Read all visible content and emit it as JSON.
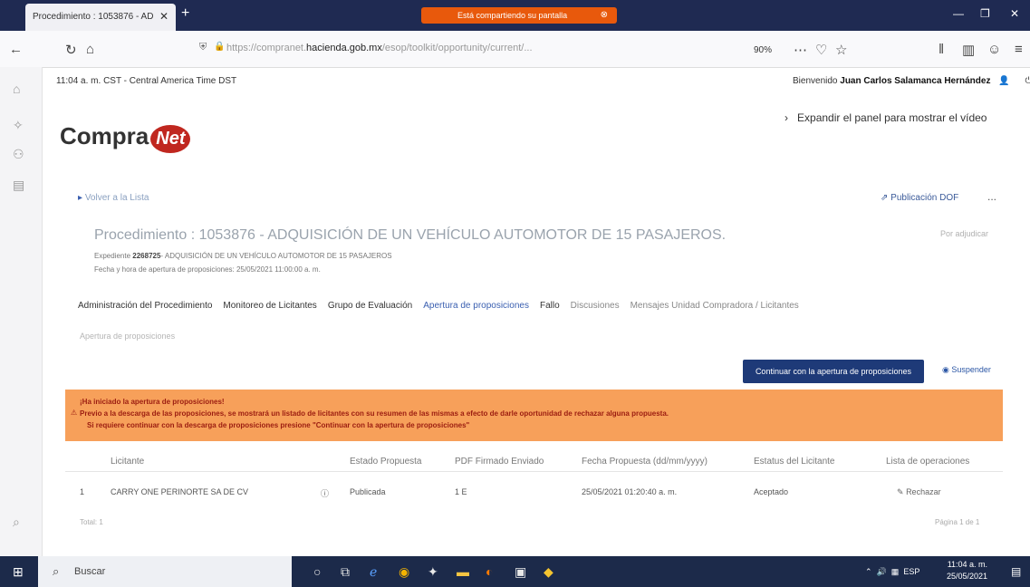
{
  "browser": {
    "tab_title": "Procedimiento : 1053876 - AD",
    "share_banner": "Está compartiendo su pantalla",
    "url_prefix": "https://compranet.",
    "url_domain": "hacienda.gob.mx",
    "url_rest": "/esop/toolkit/opportunity/current/...",
    "zoom": "90%"
  },
  "header": {
    "time_info": "11:04 a. m. CST - Central America Time DST",
    "welcome_prefix": "Bienvenido",
    "user_name": "Juan Carlos Salamanca Hernández",
    "logo_text": "Compra",
    "logo_badge": "Net",
    "expand_panel": "Expandir el panel para mostrar el vídeo"
  },
  "page": {
    "back_link": "Volver a la Lista",
    "pub_doc": "Publicación DOF",
    "more": "...",
    "proc_title": "Procedimiento : 1053876 - ADQUISICIÓN DE UN VEHÍCULO AUTOMOTOR DE 15 PASAJEROS.",
    "proc_side": "Por adjudicar",
    "exp_label": "Expediente",
    "exp_number": "2268725",
    "exp_desc": "- ADQUISICIÓN DE UN VEHÍCULO AUTOMOTOR DE 15 PASAJEROS",
    "fecha_line": "Fecha y hora de apertura de proposiciones: 25/05/2021 11:00:00 a. m.",
    "subtitle": "Apertura de proposiciones"
  },
  "tabs": [
    {
      "label": "Administración del Procedimiento",
      "state": "normal"
    },
    {
      "label": "Monitoreo de Licitantes",
      "state": "normal"
    },
    {
      "label": "Grupo de Evaluación",
      "state": "normal"
    },
    {
      "label": "Apertura de proposiciones",
      "state": "active"
    },
    {
      "label": "Fallo",
      "state": "normal"
    },
    {
      "label": "Discusiones",
      "state": "dim"
    },
    {
      "label": "Mensajes Unidad Compradora / Licitantes",
      "state": "dim"
    }
  ],
  "actions": {
    "continue": "Continuar con la apertura de proposiciones",
    "suspend": "Suspender"
  },
  "alert": {
    "line1": "¡Ha iniciado la apertura de proposiciones!",
    "line2": "Previo a la descarga de las proposiciones, se mostrará un listado de licitantes con su resumen de las mismas a efecto de darle oportunidad de rechazar alguna propuesta.",
    "line3": "Si requiere continuar con la descarga de proposiciones presione \"Continuar con la apertura de proposiciones\""
  },
  "table": {
    "headers": [
      "Licitante",
      "Estado Propuesta",
      "PDF Firmado Enviado",
      "Fecha Propuesta (dd/mm/yyyy)",
      "Estatus del Licitante",
      "Lista de operaciones"
    ],
    "row": {
      "num": "1",
      "licitante": "CARRY ONE PERINORTE SA DE CV",
      "estado": "Publicada",
      "pdf": "1 E",
      "fecha": "25/05/2021 01:20:40 a. m.",
      "estatus": "Aceptado",
      "operacion": "Rechazar"
    },
    "total": "Total: 1",
    "page_info": "Página 1 de 1"
  },
  "taskbar": {
    "search": "Buscar",
    "time": "11:04 a. m.",
    "date": "25/05/2021",
    "lang": "ESP"
  }
}
